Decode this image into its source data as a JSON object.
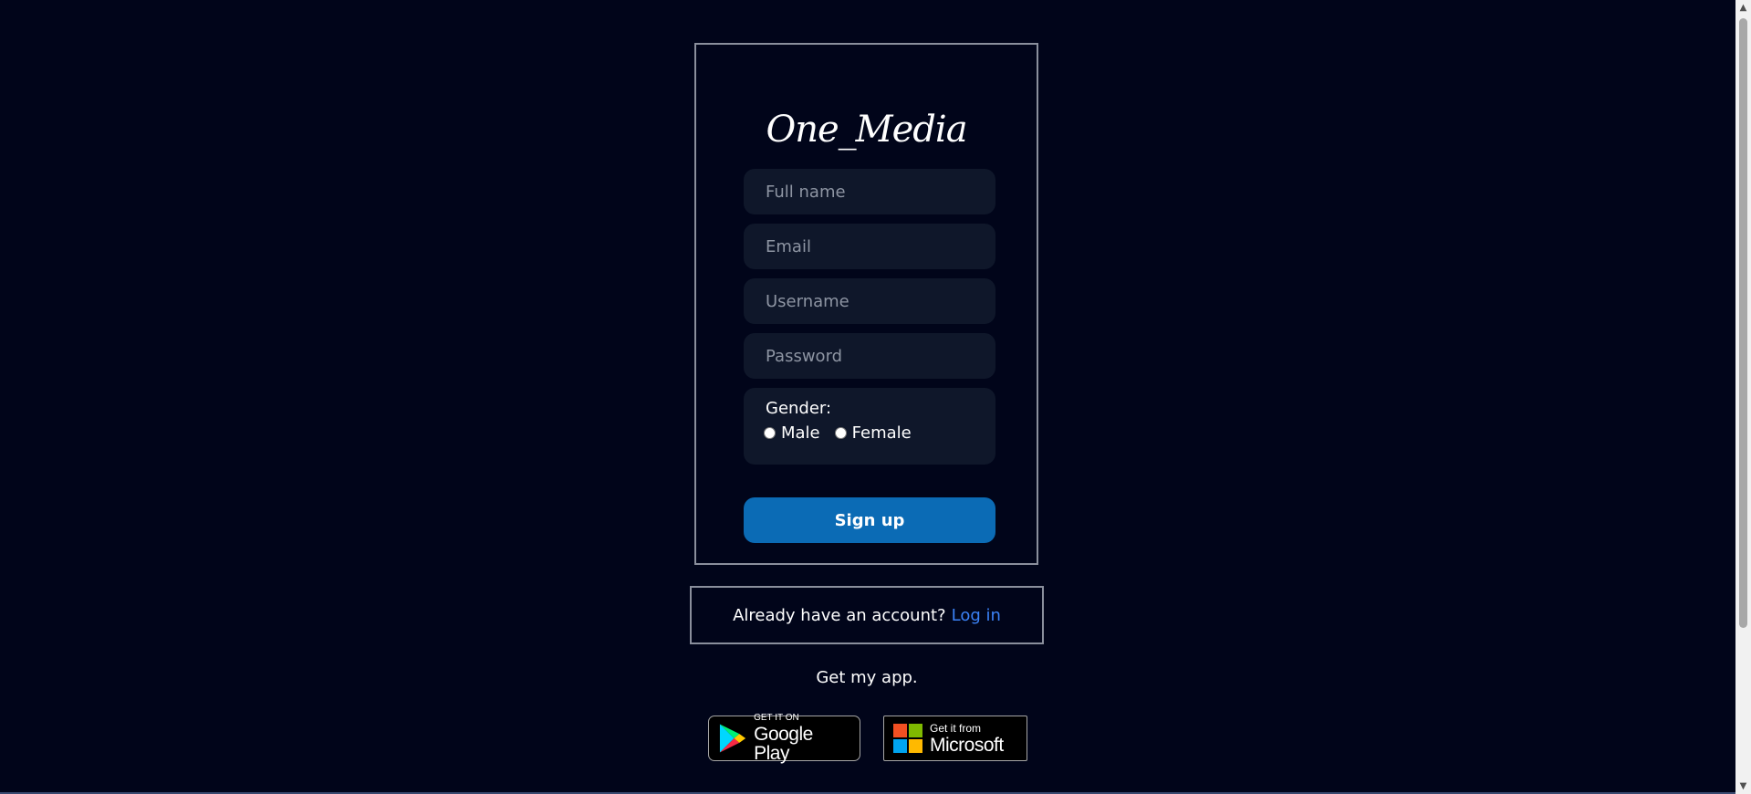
{
  "brand": "One_Media",
  "form": {
    "full_name_placeholder": "Full name",
    "email_placeholder": "Email",
    "username_placeholder": "Username",
    "password_placeholder": "Password",
    "gender_label": "Gender:",
    "gender_options": [
      "Male",
      "Female"
    ],
    "signup_label": "Sign up"
  },
  "login": {
    "prompt": "Already have an account?",
    "link": "Log in"
  },
  "get_app": "Get my app.",
  "badges": {
    "google_play": {
      "small": "GET IT ON",
      "big": "Google Play"
    },
    "microsoft": {
      "small": "Get it from",
      "big": "Microsoft"
    }
  },
  "colors": {
    "background": "#01051a",
    "field_bg": "#0f172a",
    "button": "#0b6bb5",
    "link": "#3b82f6"
  }
}
